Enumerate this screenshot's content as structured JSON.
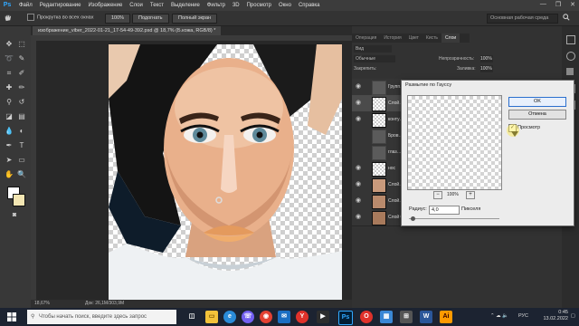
{
  "app": {
    "logo": "Ps"
  },
  "menu": [
    "Файл",
    "Редактирование",
    "Изображение",
    "Слои",
    "Текст",
    "Выделение",
    "Фильтр",
    "3D",
    "Просмотр",
    "Окно",
    "Справка"
  ],
  "window_controls": [
    "—",
    "❐",
    "✕"
  ],
  "options_bar": {
    "scroll_all_label": "Прокрутка во всех окнах",
    "zoom_value": "100%",
    "fit_screen": "Подогнать",
    "full_screen": "Полный экран",
    "workspace_search": "Основная рабочая среда"
  },
  "document": {
    "tab_title": "изображение_viber_2022-01-21_17-54-49-392.psd @ 18,7% (Б.кожа, RGB/8) *",
    "zoom": "18,67%",
    "doc_size": "Док: 26,1M/303,9M"
  },
  "panels": {
    "tabs": [
      "Операция",
      "История",
      "Цвет",
      "Кисть",
      "Слои"
    ],
    "active_tab": "Слои",
    "kind_label": "Вид",
    "blend_mode": "Обычные",
    "opacity_label": "Непрозрачность:",
    "opacity_value": "100%",
    "lock_label": "Закрепить:",
    "fill_label": "Заливка:",
    "fill_value": "100%",
    "layers": [
      {
        "name": "Групп…",
        "type": "group"
      },
      {
        "name": "Слой…",
        "type": "layer",
        "selected": true
      },
      {
        "name": "конту…",
        "type": "layer"
      },
      {
        "name": "Бров…",
        "type": "group"
      },
      {
        "name": "глаз…",
        "type": "group"
      },
      {
        "name": "нос",
        "type": "layer"
      },
      {
        "name": "Слой…",
        "type": "photo"
      },
      {
        "name": "Слой…",
        "type": "photo"
      },
      {
        "name": "Слой 0",
        "type": "photo"
      }
    ]
  },
  "dialog": {
    "title": "Размытие по Гауссу",
    "ok": "OK",
    "cancel": "Отмена",
    "preview_label": "Просмотр",
    "preview_checked": true,
    "preview_zoom": "100%",
    "zoom_out": "−",
    "zoom_in": "+",
    "radius_label": "Радиус:",
    "radius_value": "4,0",
    "radius_unit": "Пикселя",
    "radius_slider_fraction": 0.04
  },
  "taskbar": {
    "search_placeholder": "Чтобы начать поиск, введите здесь запрос",
    "language": "РУС",
    "time": "0:45",
    "date": "13.02.2022",
    "apps": [
      "task-view",
      "explorer",
      "edge",
      "viber",
      "chrome",
      "mail",
      "yandex",
      "photoshop",
      "opera",
      "files",
      "store",
      "word",
      "illustrator",
      "media"
    ]
  },
  "colors": {
    "accent": "#31a8ff",
    "dialog_bg": "#ececec",
    "panel_bg": "#323232",
    "taskbar_bg": "#1c2331"
  }
}
